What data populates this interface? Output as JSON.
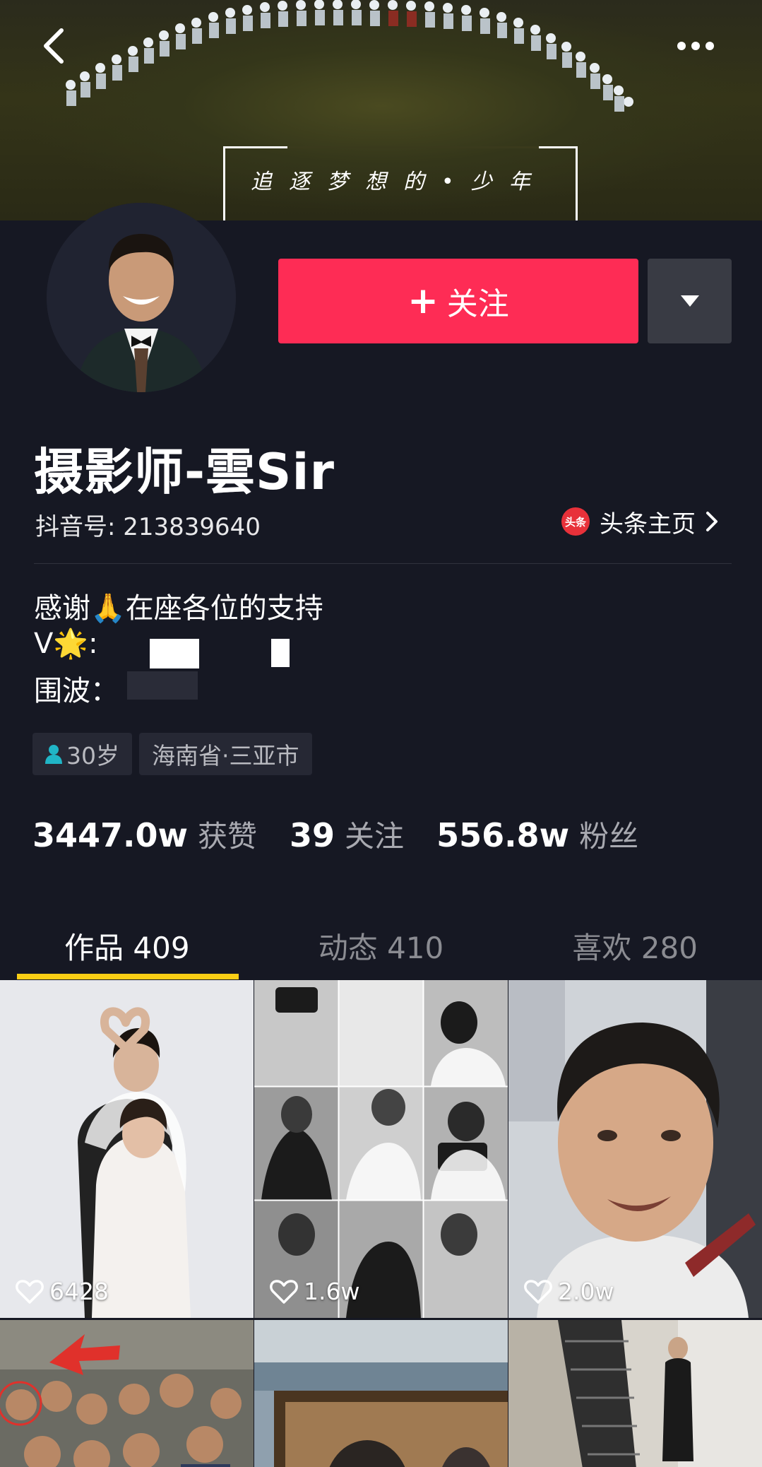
{
  "cover": {
    "slogan": "追逐梦想的•少年"
  },
  "profile": {
    "follow_label": "关注",
    "nickname": "摄影师-雲Sir",
    "douyin_id": "抖音号: 213839640",
    "toutiao_badge": "头条",
    "toutiao_label": "头条主页",
    "bio": [
      "感谢🙏在座各位的支持",
      "V🌟:",
      "围波："
    ],
    "tags": [
      {
        "icon": "person-icon",
        "label": "30岁"
      },
      {
        "label": "海南省·三亚市"
      }
    ],
    "stats": [
      {
        "value": "3447.0w",
        "label": "获赞"
      },
      {
        "value": "39",
        "label": "关注"
      },
      {
        "value": "556.8w",
        "label": "粉丝"
      }
    ]
  },
  "tabs": [
    {
      "label": "作品 409",
      "active": true
    },
    {
      "label": "动态 410",
      "active": false
    },
    {
      "label": "喜欢 280",
      "active": false
    }
  ],
  "videos": [
    {
      "likes": "6428"
    },
    {
      "likes": "1.6w"
    },
    {
      "likes": "2.0w"
    },
    {
      "likes": ""
    },
    {
      "likes": ""
    },
    {
      "likes": ""
    }
  ],
  "colors": {
    "background": "#161823",
    "follow_button": "#fe2c55",
    "tab_indicator": "#face15"
  }
}
